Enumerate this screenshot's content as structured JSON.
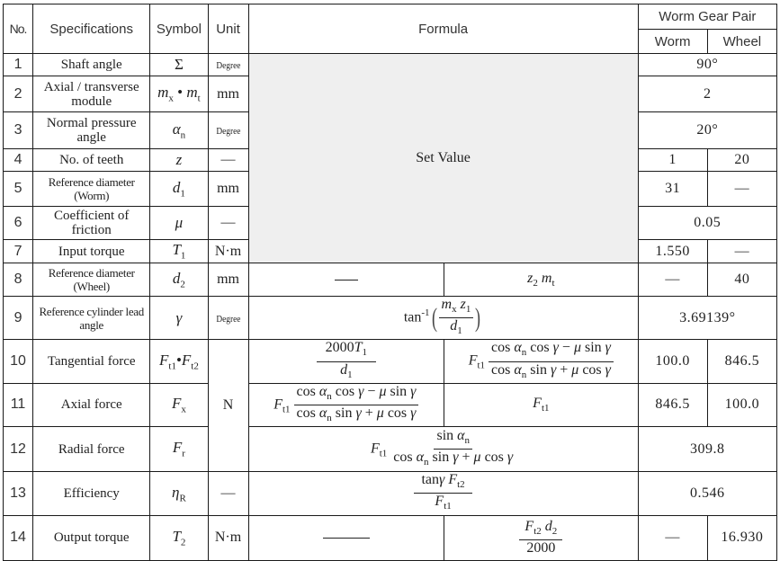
{
  "header": {
    "no": "No.",
    "specifications": "Specifications",
    "symbol": "Symbol",
    "unit": "Unit",
    "formula": "Formula",
    "pair": "Worm Gear Pair",
    "worm": "Worm",
    "wheel": "Wheel"
  },
  "set_value_label": "Set Value",
  "rows": [
    {
      "no": "1",
      "spec": "Shaft angle",
      "symbol": "Σ",
      "unit": "Degree",
      "value": "90°"
    },
    {
      "no": "2",
      "spec": "Axial / transverse module",
      "symbol_a": "m",
      "symbol_a_sub": "x",
      "symbol_sep": " • ",
      "symbol_b": "m",
      "symbol_b_sub": "t",
      "unit": "mm",
      "value": "2"
    },
    {
      "no": "3",
      "spec": "Normal pressure angle",
      "symbol": "α",
      "symbol_sub": "n",
      "unit": "Degree",
      "value": "20°"
    },
    {
      "no": "4",
      "spec": "No. of teeth",
      "symbol": "z",
      "unit": "—",
      "worm": "1",
      "wheel": "20"
    },
    {
      "no": "5",
      "spec": "Reference diameter (Worm)",
      "symbol": "d",
      "symbol_sub": "1",
      "unit": "mm",
      "worm": "31",
      "wheel": "—"
    },
    {
      "no": "6",
      "spec": "Coefficient of friction",
      "symbol": "μ",
      "unit": "—",
      "value": "0.05"
    },
    {
      "no": "7",
      "spec": "Input torque",
      "symbol": "T",
      "symbol_sub": "1",
      "unit": "N·m",
      "worm": "1.550",
      "wheel": "—"
    },
    {
      "no": "8",
      "spec": "Reference diameter (Wheel)",
      "symbol": "d",
      "symbol_sub": "2",
      "unit": "mm",
      "formula_worm": "—",
      "formula_wheel": "z₂ mₜ",
      "worm": "—",
      "wheel": "40"
    },
    {
      "no": "9",
      "spec": "Reference cylinder lead angle",
      "symbol": "γ",
      "unit": "Degree",
      "formula": "tan⁻¹(mₓ z₁ / d₁)",
      "value": "3.69139°"
    },
    {
      "no": "10",
      "spec": "Tangential force",
      "symbol": "Ft1•Ft2",
      "unit": "N",
      "formula_worm": "2000T₁ / d₁",
      "formula_wheel": "Ft1 (cos αn cos γ − μ sin γ) / (cos αn sin γ + μ cos γ)",
      "worm": "100.0",
      "wheel": "846.5"
    },
    {
      "no": "11",
      "spec": "Axial force",
      "symbol": "F",
      "symbol_sub": "x",
      "formula_worm": "Ft1 (cos αn cos γ − μ sin γ) / (cos αn sin γ + μ cos γ)",
      "formula_wheel": "Ft1",
      "worm": "846.5",
      "wheel": "100.0"
    },
    {
      "no": "12",
      "spec": "Radial force",
      "symbol": "F",
      "symbol_sub": "r",
      "formula": "Ft1 sin αn / (cos αn sin γ + μ cos γ)",
      "value": "309.8"
    },
    {
      "no": "13",
      "spec": "Efficiency",
      "symbol": "η",
      "symbol_sub": "R",
      "unit": "—",
      "formula": "tanγ Ft2 / Ft1",
      "value": "0.546"
    },
    {
      "no": "14",
      "spec": "Output torque",
      "symbol": "T",
      "symbol_sub": "2",
      "unit": "N·m",
      "formula_worm": "—",
      "formula_wheel": "Ft2 d2 / 2000",
      "worm": "—",
      "wheel": "16.930"
    }
  ],
  "math": {
    "cos": "cos",
    "sin": "sin",
    "tan": "tan",
    "tan_inv_sup": "-1",
    "alpha": "α",
    "gamma": "γ",
    "mu": "μ",
    "minus": " − ",
    "plus": " + ",
    "F": "F",
    "t1": "t1",
    "t2": "t2",
    "n": "n",
    "m": "m",
    "x": "x",
    "t": "t",
    "z": "z",
    "d": "d",
    "one": "1",
    "two": "2",
    "T": "T",
    "n2000": "2000"
  }
}
